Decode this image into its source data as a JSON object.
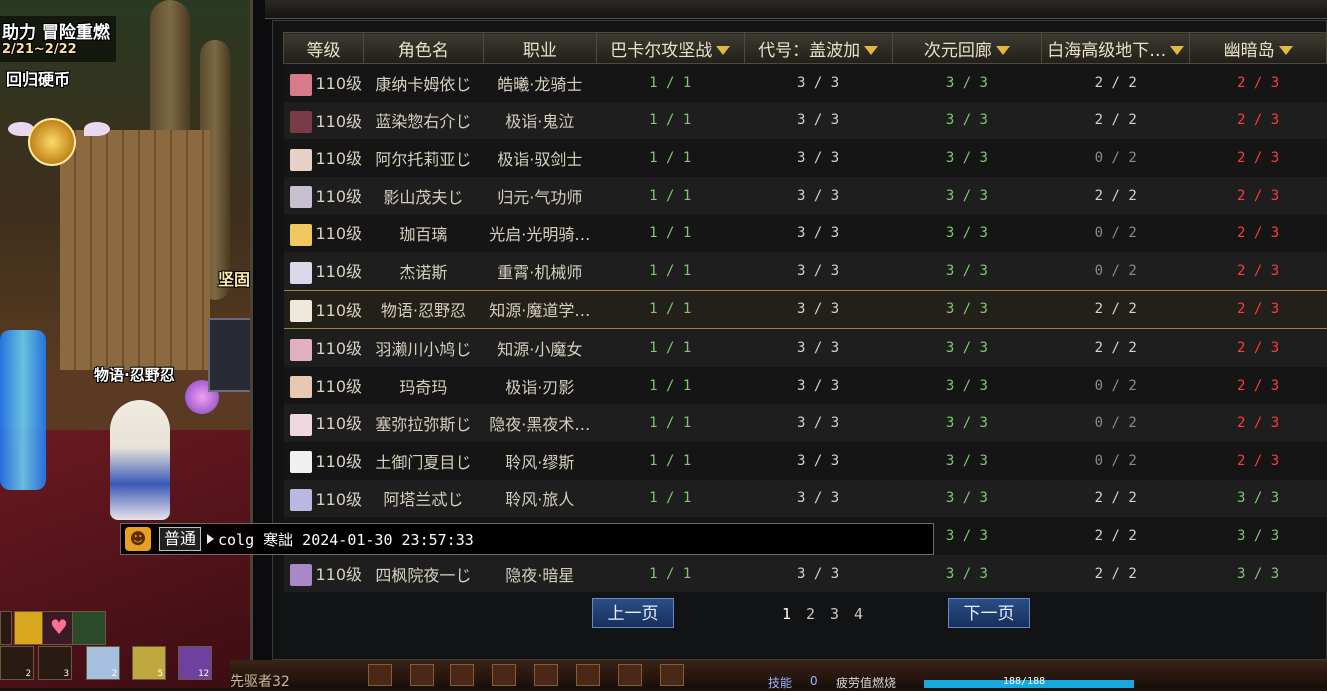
{
  "event": {
    "title": "助力 冒险重燃",
    "dates": "2/21~2/22",
    "coin_label": "回归硬币"
  },
  "scene": {
    "player_name": "物语·忍野忍",
    "npc_label": "坚固"
  },
  "table": {
    "headers": [
      {
        "label": "等级",
        "dropdown": false
      },
      {
        "label": "角色名",
        "dropdown": false
      },
      {
        "label": "职业",
        "dropdown": false
      },
      {
        "label": "巴卡尔攻坚战",
        "dropdown": true
      },
      {
        "label": "代号：盖波加",
        "dropdown": true
      },
      {
        "label": "次元回廊",
        "dropdown": true
      },
      {
        "label": "白海高级地下…",
        "dropdown": true
      },
      {
        "label": "幽暗岛",
        "dropdown": true
      }
    ],
    "rows": [
      {
        "level": "110级",
        "name": "康纳卡姆依じ",
        "job": "皓曦·龙骑士",
        "c1": "1 / 1",
        "c2": "3 / 3",
        "c3": "3 / 3",
        "c4": "2 / 2",
        "c5": "2 / 3",
        "avatar": "#d87a8a"
      },
      {
        "level": "110级",
        "name": "蓝染惣右介じ",
        "job": "极诣·鬼泣",
        "c1": "1 / 1",
        "c2": "3 / 3",
        "c3": "3 / 3",
        "c4": "2 / 2",
        "c5": "2 / 3",
        "avatar": "#7a3a48"
      },
      {
        "level": "110级",
        "name": "阿尔托莉亚じ",
        "job": "极诣·驭剑士",
        "c1": "1 / 1",
        "c2": "3 / 3",
        "c3": "3 / 3",
        "c4": "0 / 2",
        "c5": "2 / 3",
        "avatar": "#e8d0c8"
      },
      {
        "level": "110级",
        "name": "影山茂夫じ",
        "job": "归元·气功师",
        "c1": "1 / 1",
        "c2": "3 / 3",
        "c3": "3 / 3",
        "c4": "2 / 2",
        "c5": "2 / 3",
        "avatar": "#c8c0d0"
      },
      {
        "level": "110级",
        "name": "珈百璃",
        "job": "光启·光明骑…",
        "c1": "1 / 1",
        "c2": "3 / 3",
        "c3": "3 / 3",
        "c4": "0 / 2",
        "c5": "2 / 3",
        "avatar": "#f0c860"
      },
      {
        "level": "110级",
        "name": "杰诺斯",
        "job": "重霄·机械师",
        "c1": "1 / 1",
        "c2": "3 / 3",
        "c3": "3 / 3",
        "c4": "0 / 2",
        "c5": "2 / 3",
        "avatar": "#d8d8e8"
      },
      {
        "level": "110级",
        "name": "物语·忍野忍",
        "job": "知源·魔道学…",
        "c1": "1 / 1",
        "c2": "3 / 3",
        "c3": "3 / 3",
        "c4": "2 / 2",
        "c5": "2 / 3",
        "avatar": "#f0e8d8",
        "selected": true
      },
      {
        "level": "110级",
        "name": "羽濑川小鸠じ",
        "job": "知源·小魔女",
        "c1": "1 / 1",
        "c2": "3 / 3",
        "c3": "3 / 3",
        "c4": "2 / 2",
        "c5": "2 / 3",
        "avatar": "#e0b0c0"
      },
      {
        "level": "110级",
        "name": "玛奇玛",
        "job": "极诣·刃影",
        "c1": "1 / 1",
        "c2": "3 / 3",
        "c3": "3 / 3",
        "c4": "0 / 2",
        "c5": "2 / 3",
        "avatar": "#e8c8b0"
      },
      {
        "level": "110级",
        "name": "塞弥拉弥斯じ",
        "job": "隐夜·黑夜术…",
        "c1": "1 / 1",
        "c2": "3 / 3",
        "c3": "3 / 3",
        "c4": "0 / 2",
        "c5": "2 / 3",
        "avatar": "#f0d8e0"
      },
      {
        "level": "110级",
        "name": "土御门夏目じ",
        "job": "聆风·缪斯",
        "c1": "1 / 1",
        "c2": "3 / 3",
        "c3": "3 / 3",
        "c4": "0 / 2",
        "c5": "2 / 3",
        "avatar": "#f0f0f0"
      },
      {
        "level": "110级",
        "name": "阿塔兰忒じ",
        "job": "聆风·旅人",
        "c1": "1 / 1",
        "c2": "3 / 3",
        "c3": "3 / 3",
        "c4": "2 / 2",
        "c5": "3 / 3",
        "avatar": "#b8b8e0"
      },
      {
        "level": "",
        "name": "",
        "job": "",
        "c1": "",
        "c2": "",
        "c3": "3 / 3",
        "c4": "2 / 2",
        "c5": "3 / 3",
        "avatar": ""
      },
      {
        "level": "110级",
        "name": "四枫院夜一じ",
        "job": "隐夜·暗星",
        "c1": "1 / 1",
        "c2": "3 / 3",
        "c3": "3 / 3",
        "c4": "2 / 2",
        "c5": "3 / 3",
        "avatar": "#a888c8"
      }
    ]
  },
  "chat": {
    "channel": "普通",
    "text": "colg 寒詘 2024-01-30 23:57:33"
  },
  "pagination": {
    "prev": "上一页",
    "next": "下一页",
    "pages": [
      "1",
      "2",
      "3",
      "4"
    ],
    "current": "1"
  },
  "skillbar": {
    "counts": [
      "2",
      "3",
      "2",
      "5",
      "12",
      "6"
    ]
  },
  "bottombar": {
    "label": "先驱者32",
    "skill": "技能",
    "skill_points": "0",
    "fatigue": "疲劳值燃烧",
    "fatigue_value": "188/188"
  },
  "colors": {
    "done": "#7ec872",
    "neutral": "#d2d2d2",
    "incomplete": "#ff3a3a",
    "zero": "#8a8a8a",
    "accent": "#e2b840"
  }
}
